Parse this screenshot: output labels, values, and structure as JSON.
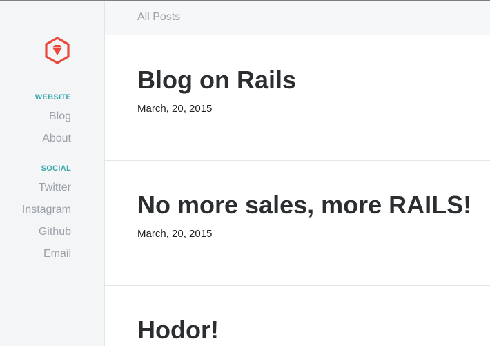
{
  "topbar": {
    "all_posts": "All Posts"
  },
  "sidebar": {
    "logo_icon": "ruby-gem-icon",
    "website_heading": "WEBSITE",
    "website_links": [
      "Blog",
      "About"
    ],
    "social_heading": "SOCIAL",
    "social_links": [
      "Twitter",
      "Instagram",
      "Github",
      "Email"
    ]
  },
  "posts": [
    {
      "title": "Blog on Rails",
      "date": "March, 20, 2015"
    },
    {
      "title": "No more sales, more RAILS!",
      "date": "March, 20, 2015"
    },
    {
      "title": "Hodor!"
    }
  ],
  "colors": {
    "accent": "#3aa7ad",
    "logo": "#e8493b",
    "muted_text": "#9aa1a8",
    "sidebar_bg": "#f4f5f6"
  }
}
